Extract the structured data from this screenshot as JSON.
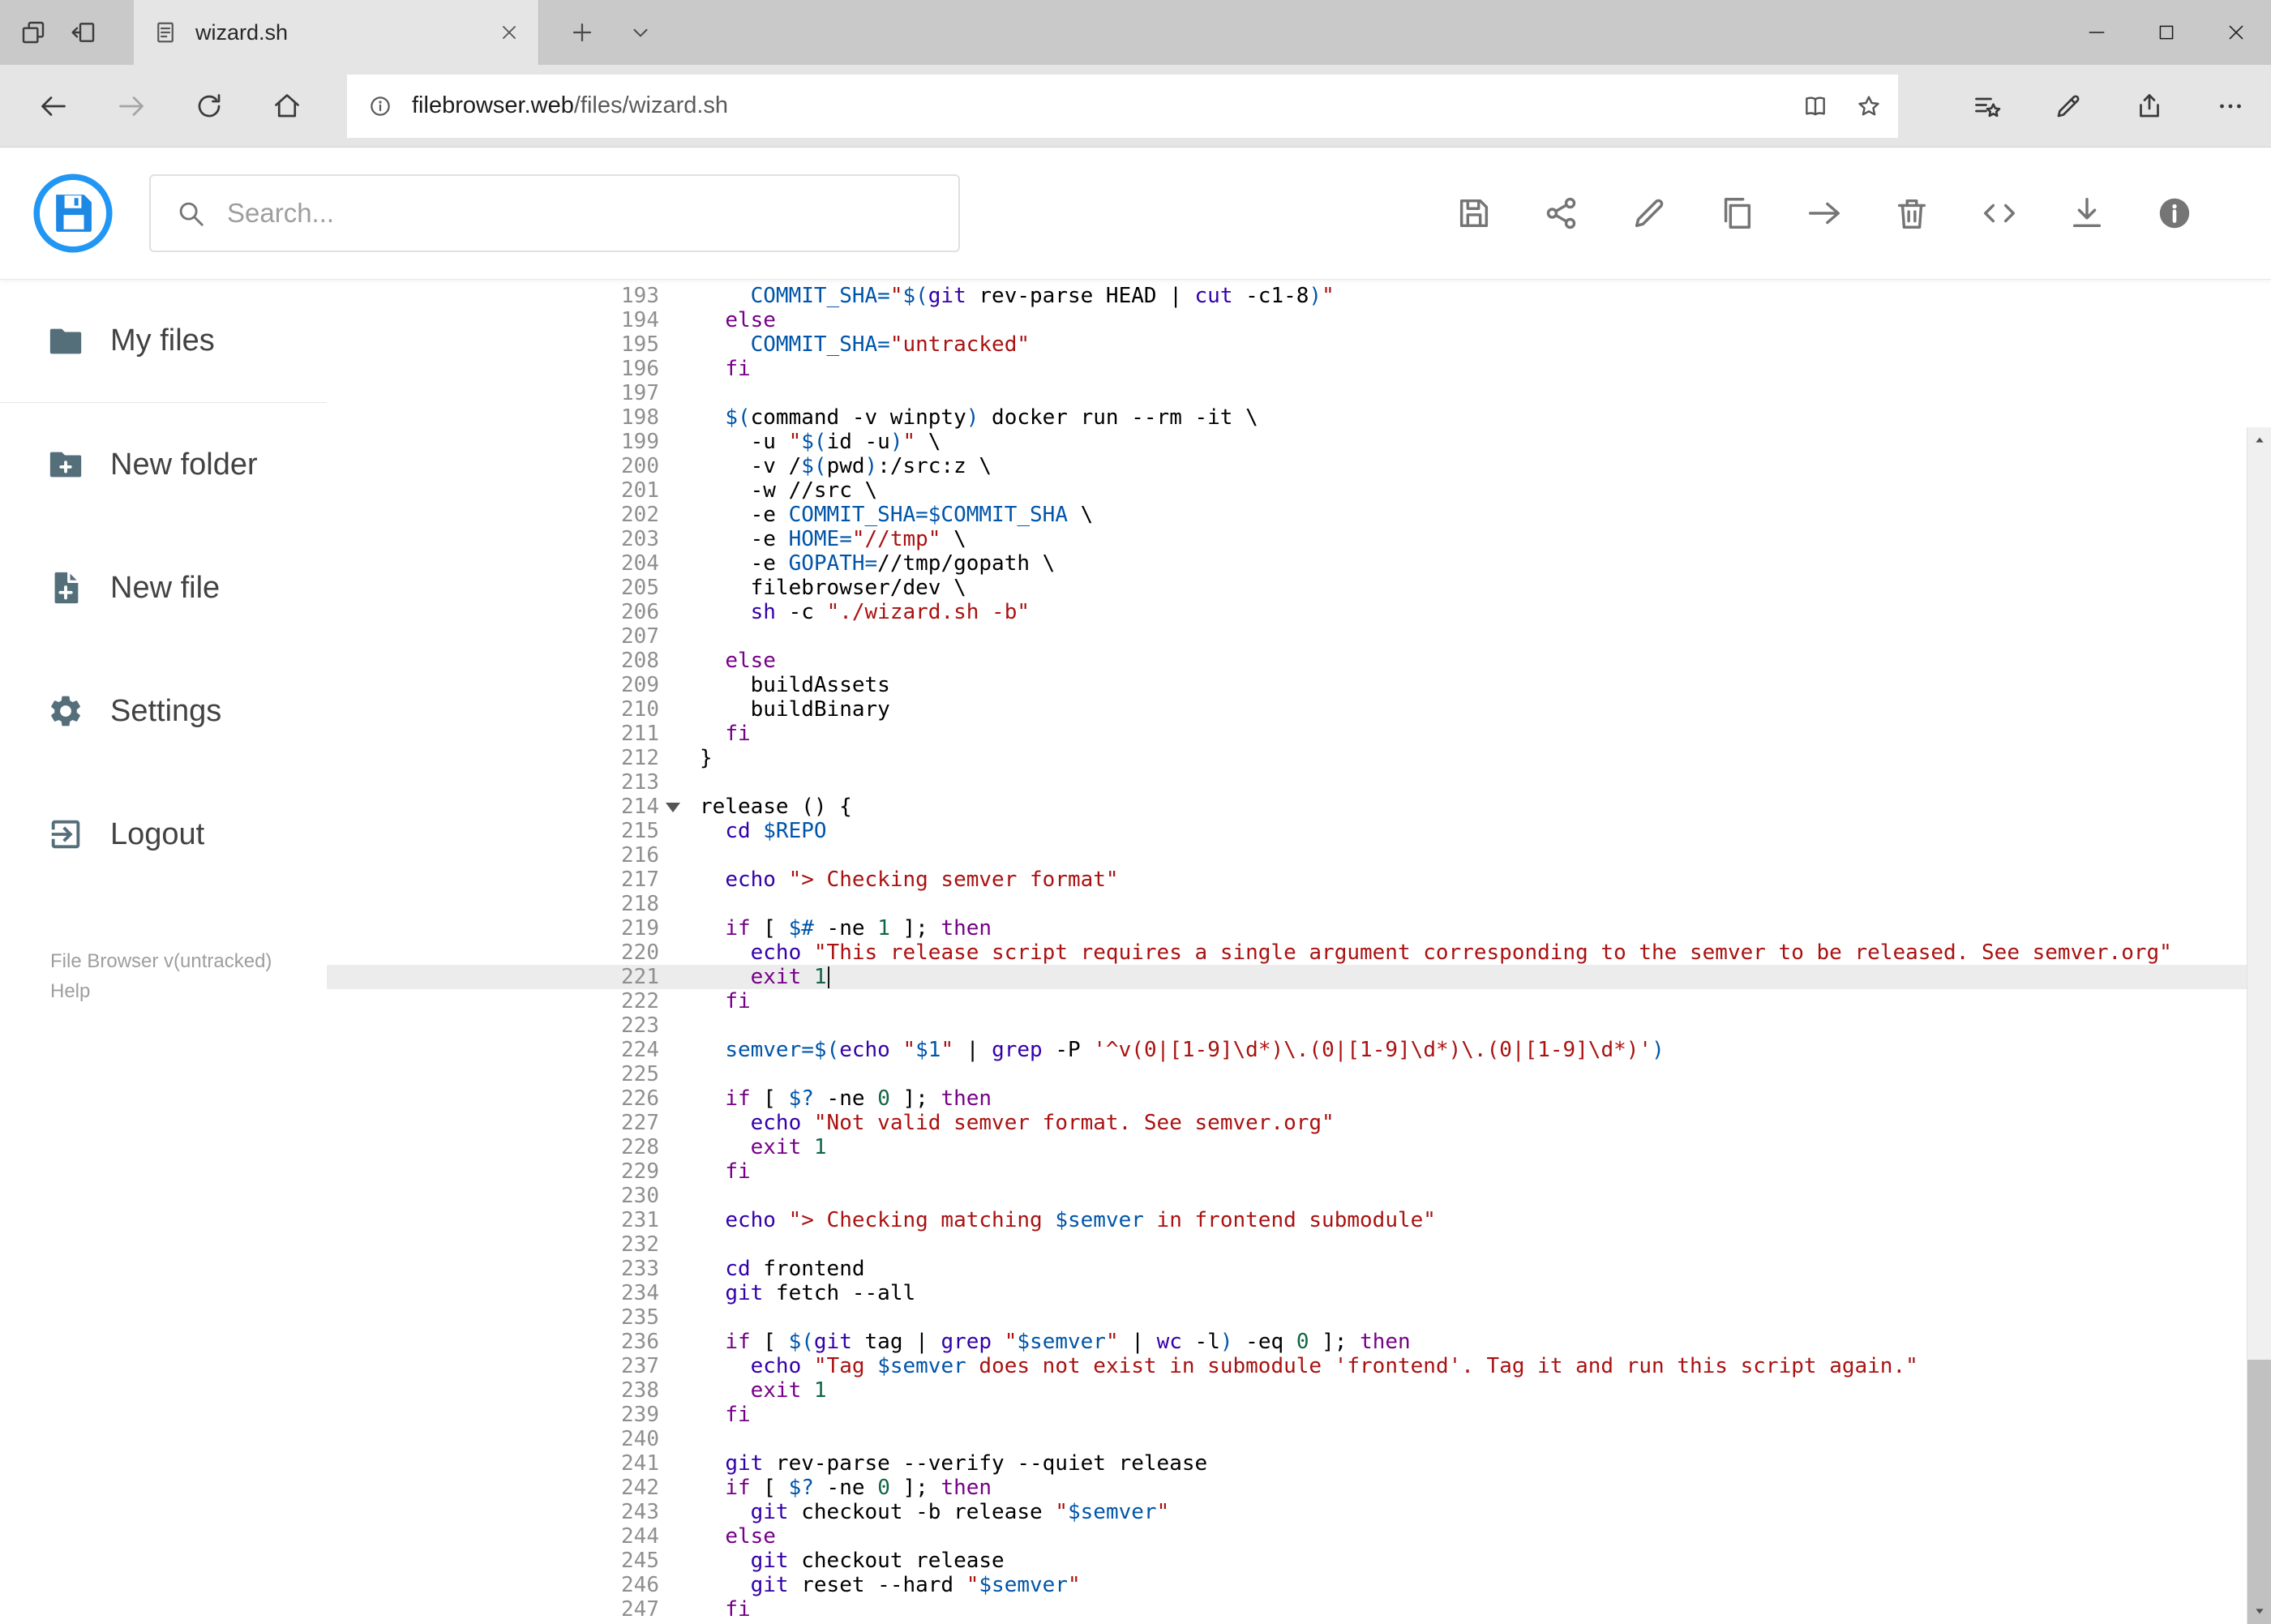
{
  "browser": {
    "tab_title": "wizard.sh",
    "url_host": "filebrowser.web",
    "url_path": "/files/wizard.sh"
  },
  "header": {
    "search_placeholder": "Search...",
    "toolbar": [
      {
        "name": "save",
        "icon": "save-icon"
      },
      {
        "name": "share",
        "icon": "share-icon"
      },
      {
        "name": "rename",
        "icon": "edit-icon"
      },
      {
        "name": "copy",
        "icon": "copy-icon"
      },
      {
        "name": "move",
        "icon": "move-icon"
      },
      {
        "name": "delete",
        "icon": "delete-icon"
      },
      {
        "name": "source",
        "icon": "code-icon"
      },
      {
        "name": "download",
        "icon": "download-icon"
      },
      {
        "name": "info",
        "icon": "info-filled-icon"
      }
    ]
  },
  "sidebar": {
    "items": [
      {
        "label": "My files",
        "icon": "folder-icon",
        "divider": true
      },
      {
        "label": "New folder",
        "icon": "new-folder-icon"
      },
      {
        "label": "New file",
        "icon": "new-file-icon"
      },
      {
        "label": "Settings",
        "icon": "settings-icon"
      },
      {
        "label": "Logout",
        "icon": "logout-icon"
      }
    ],
    "footer_version": "File Browser v(untracked)",
    "footer_help": "Help"
  },
  "colors": {
    "brand_blue": "#2196f3",
    "active_line_bg": "#ececec",
    "line_number": "#8f8f8f"
  },
  "editor": {
    "active_line": 221,
    "cursor_line": 221,
    "fold_marker_line": 214,
    "token_colors": {
      "p": "#000000",
      "k": "#770088",
      "s": "#aa1111",
      "v": "#0055aa",
      "b": "#3300aa",
      "n": "#116644"
    },
    "lines": [
      {
        "n": 193,
        "seg": [
          [
            "    ",
            "p"
          ],
          [
            "COMMIT_SHA=",
            "v"
          ],
          [
            "\"",
            "s"
          ],
          [
            "$(",
            "v"
          ],
          [
            "git",
            "b"
          ],
          [
            " rev-parse HEAD | ",
            "p"
          ],
          [
            "cut",
            "b"
          ],
          [
            " -c1-8",
            "p"
          ],
          [
            ")",
            "v"
          ],
          [
            "\"",
            "s"
          ]
        ]
      },
      {
        "n": 194,
        "seg": [
          [
            "  ",
            "p"
          ],
          [
            "else",
            "k"
          ]
        ]
      },
      {
        "n": 195,
        "seg": [
          [
            "    ",
            "p"
          ],
          [
            "COMMIT_SHA=",
            "v"
          ],
          [
            "\"untracked\"",
            "s"
          ]
        ]
      },
      {
        "n": 196,
        "seg": [
          [
            "  ",
            "p"
          ],
          [
            "fi",
            "k"
          ]
        ]
      },
      {
        "n": 197,
        "seg": []
      },
      {
        "n": 198,
        "seg": [
          [
            "  ",
            "p"
          ],
          [
            "$(",
            "v"
          ],
          [
            "command -v winpty",
            "p"
          ],
          [
            ")",
            "v"
          ],
          [
            " docker run --rm -it \\",
            "p"
          ]
        ]
      },
      {
        "n": 199,
        "seg": [
          [
            "    ",
            "p"
          ],
          [
            "-u ",
            "p"
          ],
          [
            "\"",
            "s"
          ],
          [
            "$(",
            "v"
          ],
          [
            "id -u",
            "p"
          ],
          [
            ")",
            "v"
          ],
          [
            "\"",
            "s"
          ],
          [
            " \\",
            "p"
          ]
        ]
      },
      {
        "n": 200,
        "seg": [
          [
            "    ",
            "p"
          ],
          [
            "-v /",
            "p"
          ],
          [
            "$(",
            "v"
          ],
          [
            "pwd",
            "p"
          ],
          [
            ")",
            "v"
          ],
          [
            ":/src:z \\",
            "p"
          ]
        ]
      },
      {
        "n": 201,
        "seg": [
          [
            "    ",
            "p"
          ],
          [
            "-w //src \\",
            "p"
          ]
        ]
      },
      {
        "n": 202,
        "seg": [
          [
            "    ",
            "p"
          ],
          [
            "-e ",
            "p"
          ],
          [
            "COMMIT_SHA=$COMMIT_SHA",
            "v"
          ],
          [
            " \\",
            "p"
          ]
        ]
      },
      {
        "n": 203,
        "seg": [
          [
            "    ",
            "p"
          ],
          [
            "-e ",
            "p"
          ],
          [
            "HOME=",
            "v"
          ],
          [
            "\"//tmp\"",
            "s"
          ],
          [
            " \\",
            "p"
          ]
        ]
      },
      {
        "n": 204,
        "seg": [
          [
            "    ",
            "p"
          ],
          [
            "-e ",
            "p"
          ],
          [
            "GOPATH=",
            "v"
          ],
          [
            "//tmp/gopath \\",
            "p"
          ]
        ]
      },
      {
        "n": 205,
        "seg": [
          [
            "    ",
            "p"
          ],
          [
            "filebrowser/dev \\",
            "p"
          ]
        ]
      },
      {
        "n": 206,
        "seg": [
          [
            "    ",
            "p"
          ],
          [
            "sh",
            "b"
          ],
          [
            " -c ",
            "p"
          ],
          [
            "\"./wizard.sh -b\"",
            "s"
          ]
        ]
      },
      {
        "n": 207,
        "seg": []
      },
      {
        "n": 208,
        "seg": [
          [
            "  ",
            "p"
          ],
          [
            "else",
            "k"
          ]
        ]
      },
      {
        "n": 209,
        "seg": [
          [
            "    ",
            "p"
          ],
          [
            "buildAssets",
            "p"
          ]
        ]
      },
      {
        "n": 210,
        "seg": [
          [
            "    ",
            "p"
          ],
          [
            "buildBinary",
            "p"
          ]
        ]
      },
      {
        "n": 211,
        "seg": [
          [
            "  ",
            "p"
          ],
          [
            "fi",
            "k"
          ]
        ]
      },
      {
        "n": 212,
        "seg": [
          [
            "}",
            "p"
          ]
        ]
      },
      {
        "n": 213,
        "seg": []
      },
      {
        "n": 214,
        "seg": [
          [
            "release () {",
            "p"
          ]
        ]
      },
      {
        "n": 215,
        "seg": [
          [
            "  ",
            "p"
          ],
          [
            "cd",
            "b"
          ],
          [
            " ",
            "p"
          ],
          [
            "$REPO",
            "v"
          ]
        ]
      },
      {
        "n": 216,
        "seg": []
      },
      {
        "n": 217,
        "seg": [
          [
            "  ",
            "p"
          ],
          [
            "echo",
            "b"
          ],
          [
            " ",
            "p"
          ],
          [
            "\"> Checking semver format\"",
            "s"
          ]
        ]
      },
      {
        "n": 218,
        "seg": []
      },
      {
        "n": 219,
        "seg": [
          [
            "  ",
            "p"
          ],
          [
            "if",
            "k"
          ],
          [
            " [ ",
            "p"
          ],
          [
            "$#",
            "v"
          ],
          [
            " -ne ",
            "p"
          ],
          [
            "1",
            "n"
          ],
          [
            " ]; ",
            "p"
          ],
          [
            "then",
            "k"
          ]
        ]
      },
      {
        "n": 220,
        "seg": [
          [
            "    ",
            "p"
          ],
          [
            "echo",
            "b"
          ],
          [
            " ",
            "p"
          ],
          [
            "\"This release script requires a single argument corresponding to the semver to be released. See semver.org\"",
            "s"
          ]
        ]
      },
      {
        "n": 221,
        "seg": [
          [
            "    ",
            "p"
          ],
          [
            "exit",
            "k"
          ],
          [
            " ",
            "p"
          ],
          [
            "1",
            "n"
          ]
        ]
      },
      {
        "n": 222,
        "seg": [
          [
            "  ",
            "p"
          ],
          [
            "fi",
            "k"
          ]
        ]
      },
      {
        "n": 223,
        "seg": []
      },
      {
        "n": 224,
        "seg": [
          [
            "  ",
            "p"
          ],
          [
            "semver=",
            "v"
          ],
          [
            "$(",
            "v"
          ],
          [
            "echo",
            "b"
          ],
          [
            " ",
            "p"
          ],
          [
            "\"",
            "s"
          ],
          [
            "$1",
            "v"
          ],
          [
            "\"",
            "s"
          ],
          [
            " | ",
            "p"
          ],
          [
            "grep",
            "b"
          ],
          [
            " -P ",
            "p"
          ],
          [
            "'^v(0|[1-9]\\d*)\\.(0|[1-9]\\d*)\\.(0|[1-9]\\d*)'",
            "s"
          ],
          [
            ")",
            "v"
          ]
        ]
      },
      {
        "n": 225,
        "seg": []
      },
      {
        "n": 226,
        "seg": [
          [
            "  ",
            "p"
          ],
          [
            "if",
            "k"
          ],
          [
            " [ ",
            "p"
          ],
          [
            "$?",
            "v"
          ],
          [
            " -ne ",
            "p"
          ],
          [
            "0",
            "n"
          ],
          [
            " ]; ",
            "p"
          ],
          [
            "then",
            "k"
          ]
        ]
      },
      {
        "n": 227,
        "seg": [
          [
            "    ",
            "p"
          ],
          [
            "echo",
            "b"
          ],
          [
            " ",
            "p"
          ],
          [
            "\"Not valid semver format. See semver.org\"",
            "s"
          ]
        ]
      },
      {
        "n": 228,
        "seg": [
          [
            "    ",
            "p"
          ],
          [
            "exit",
            "k"
          ],
          [
            " ",
            "p"
          ],
          [
            "1",
            "n"
          ]
        ]
      },
      {
        "n": 229,
        "seg": [
          [
            "  ",
            "p"
          ],
          [
            "fi",
            "k"
          ]
        ]
      },
      {
        "n": 230,
        "seg": []
      },
      {
        "n": 231,
        "seg": [
          [
            "  ",
            "p"
          ],
          [
            "echo",
            "b"
          ],
          [
            " ",
            "p"
          ],
          [
            "\"> Checking matching ",
            "s"
          ],
          [
            "$semver",
            "v"
          ],
          [
            " in frontend submodule\"",
            "s"
          ]
        ]
      },
      {
        "n": 232,
        "seg": []
      },
      {
        "n": 233,
        "seg": [
          [
            "  ",
            "p"
          ],
          [
            "cd",
            "b"
          ],
          [
            " frontend",
            "p"
          ]
        ]
      },
      {
        "n": 234,
        "seg": [
          [
            "  ",
            "p"
          ],
          [
            "git",
            "b"
          ],
          [
            " fetch --all",
            "p"
          ]
        ]
      },
      {
        "n": 235,
        "seg": []
      },
      {
        "n": 236,
        "seg": [
          [
            "  ",
            "p"
          ],
          [
            "if",
            "k"
          ],
          [
            " [ ",
            "p"
          ],
          [
            "$(",
            "v"
          ],
          [
            "git",
            "b"
          ],
          [
            " tag | ",
            "p"
          ],
          [
            "grep",
            "b"
          ],
          [
            " ",
            "p"
          ],
          [
            "\"",
            "s"
          ],
          [
            "$semver",
            "v"
          ],
          [
            "\"",
            "s"
          ],
          [
            " | ",
            "p"
          ],
          [
            "wc",
            "b"
          ],
          [
            " -l",
            "p"
          ],
          [
            ")",
            "v"
          ],
          [
            " -eq ",
            "p"
          ],
          [
            "0",
            "n"
          ],
          [
            " ]; ",
            "p"
          ],
          [
            "then",
            "k"
          ]
        ]
      },
      {
        "n": 237,
        "seg": [
          [
            "    ",
            "p"
          ],
          [
            "echo",
            "b"
          ],
          [
            " ",
            "p"
          ],
          [
            "\"Tag ",
            "s"
          ],
          [
            "$semver",
            "v"
          ],
          [
            " does not exist in submodule 'frontend'. Tag it and run this script again.\"",
            "s"
          ]
        ]
      },
      {
        "n": 238,
        "seg": [
          [
            "    ",
            "p"
          ],
          [
            "exit",
            "k"
          ],
          [
            " ",
            "p"
          ],
          [
            "1",
            "n"
          ]
        ]
      },
      {
        "n": 239,
        "seg": [
          [
            "  ",
            "p"
          ],
          [
            "fi",
            "k"
          ]
        ]
      },
      {
        "n": 240,
        "seg": []
      },
      {
        "n": 241,
        "seg": [
          [
            "  ",
            "p"
          ],
          [
            "git",
            "b"
          ],
          [
            " rev-parse --verify --quiet release",
            "p"
          ]
        ]
      },
      {
        "n": 242,
        "seg": [
          [
            "  ",
            "p"
          ],
          [
            "if",
            "k"
          ],
          [
            " [ ",
            "p"
          ],
          [
            "$?",
            "v"
          ],
          [
            " -ne ",
            "p"
          ],
          [
            "0",
            "n"
          ],
          [
            " ]; ",
            "p"
          ],
          [
            "then",
            "k"
          ]
        ]
      },
      {
        "n": 243,
        "seg": [
          [
            "    ",
            "p"
          ],
          [
            "git",
            "b"
          ],
          [
            " checkout -b release ",
            "p"
          ],
          [
            "\"",
            "s"
          ],
          [
            "$semver",
            "v"
          ],
          [
            "\"",
            "s"
          ]
        ]
      },
      {
        "n": 244,
        "seg": [
          [
            "  ",
            "p"
          ],
          [
            "else",
            "k"
          ]
        ]
      },
      {
        "n": 245,
        "seg": [
          [
            "    ",
            "p"
          ],
          [
            "git",
            "b"
          ],
          [
            " checkout release",
            "p"
          ]
        ]
      },
      {
        "n": 246,
        "seg": [
          [
            "    ",
            "p"
          ],
          [
            "git",
            "b"
          ],
          [
            " reset --hard ",
            "p"
          ],
          [
            "\"",
            "s"
          ],
          [
            "$semver",
            "v"
          ],
          [
            "\"",
            "s"
          ]
        ]
      },
      {
        "n": 247,
        "seg": [
          [
            "  ",
            "p"
          ],
          [
            "fi",
            "k"
          ]
        ]
      }
    ]
  }
}
